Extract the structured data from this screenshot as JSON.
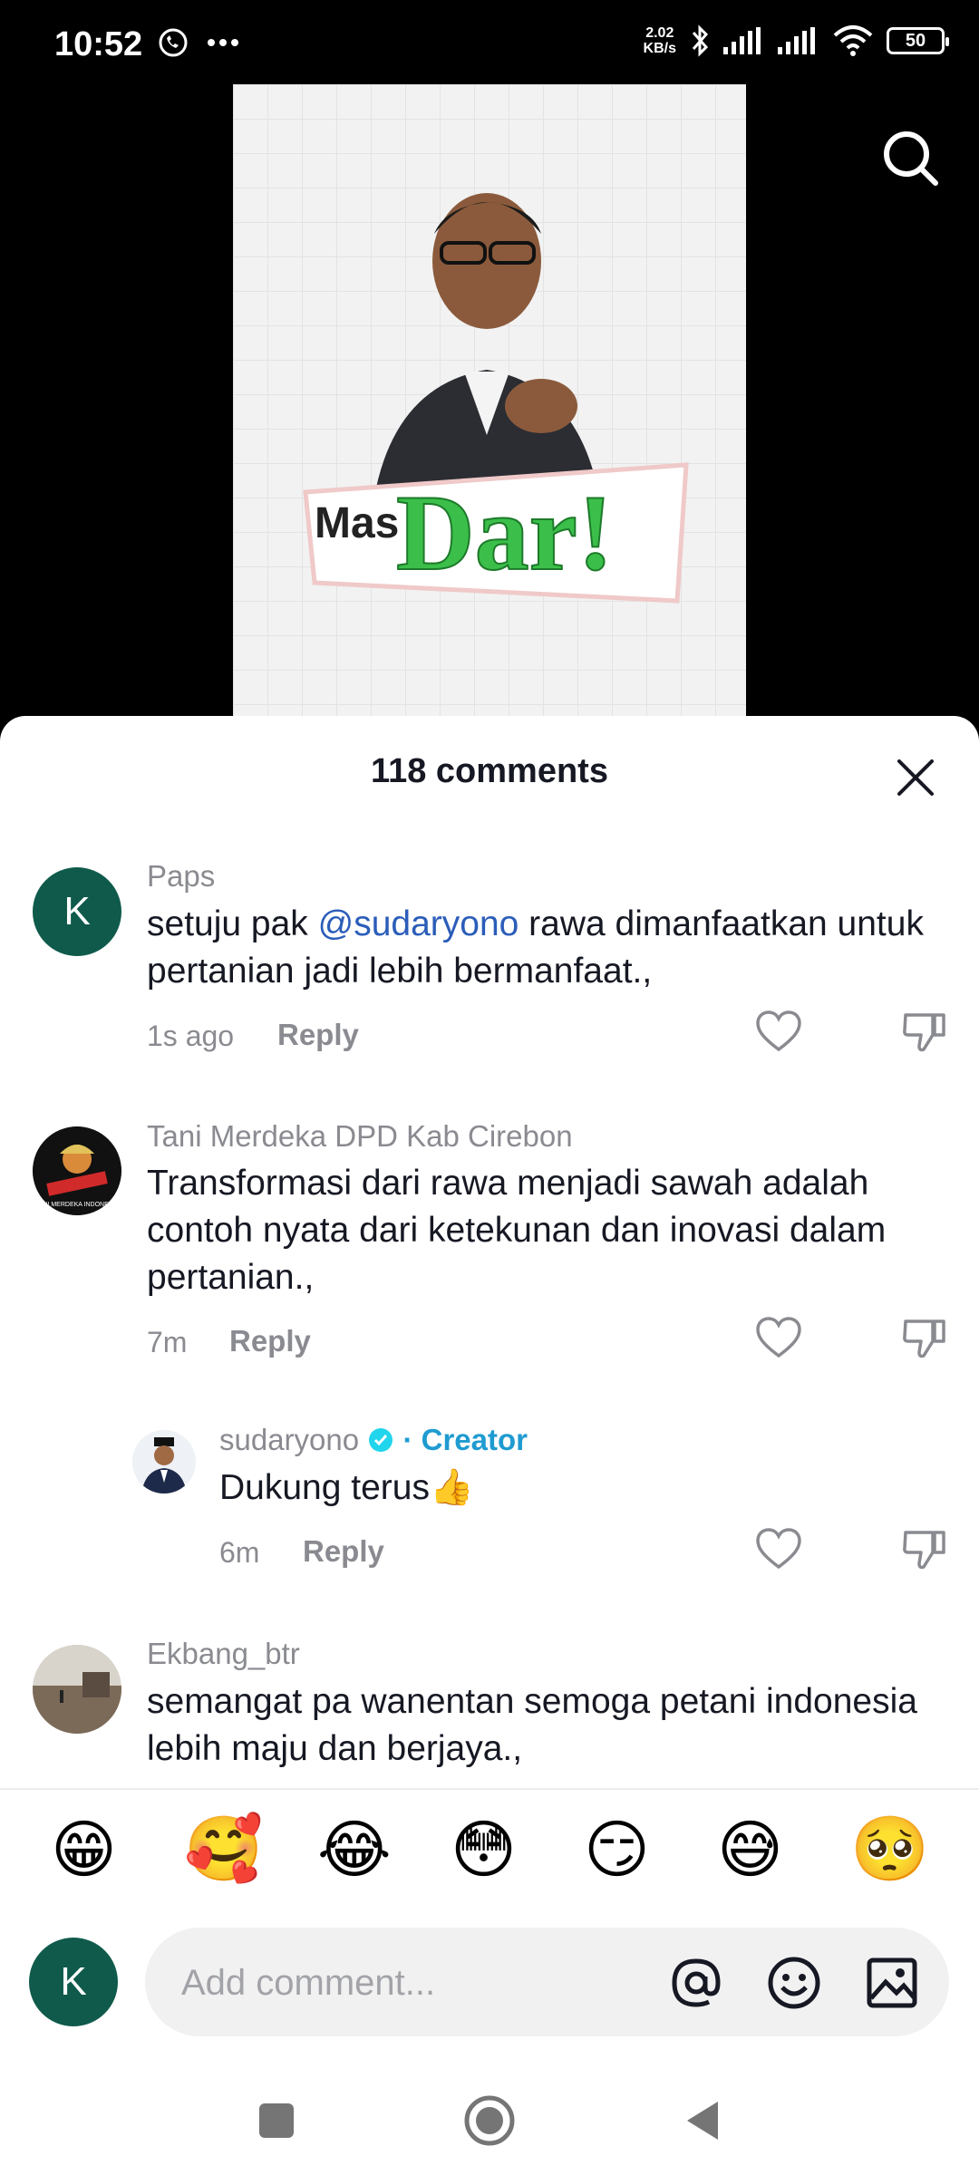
{
  "status_bar": {
    "time": "10:52",
    "net_speed_value": "2.02",
    "net_speed_unit": "KB/s",
    "battery": "50",
    "icons": [
      "whatsapp-icon",
      "more-icon",
      "bluetooth-icon",
      "signal-icon",
      "signal-icon",
      "wifi-icon",
      "battery-icon"
    ]
  },
  "video": {
    "logo_small": "Mas",
    "logo_big": "Dar!"
  },
  "comments_sheet": {
    "title": "118 comments",
    "comments": [
      {
        "avatar_letter": "K",
        "username": "Paps",
        "text_prefix": "setuju pak ",
        "mention": "@sudaryono",
        "text_suffix": " rawa dimanfaatkan untuk pertanian jadi lebih bermanfaat.,",
        "time": "1s ago",
        "reply_label": "Reply"
      },
      {
        "username": "Tani Merdeka DPD Kab Cirebon",
        "text": "Transformasi dari rawa menjadi sawah adalah contoh nyata dari ketekunan dan inovasi dalam pertanian.,",
        "time": "7m",
        "reply_label": "Reply",
        "avatar_text": "TANI MERDEKA INDONESIA"
      },
      {
        "username": "sudaryono",
        "badge": "· Creator",
        "text": "Dukung terus👍",
        "time": "6m",
        "reply_label": "Reply"
      },
      {
        "username": "Ekbang_btr",
        "text": "semangat pa wanentan semoga petani indonesia lebih maju dan berjaya.,"
      }
    ]
  },
  "emoji_bar": [
    "😁",
    "🥰",
    "😂",
    "😳",
    "😏",
    "😅",
    "🥺"
  ],
  "composer": {
    "avatar_letter": "K",
    "placeholder": "Add comment..."
  }
}
